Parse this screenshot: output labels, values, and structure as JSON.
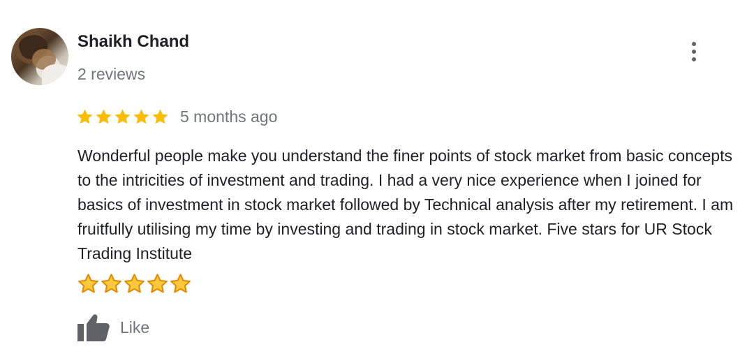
{
  "reviewer": {
    "name": "Shaikh Chand",
    "review_count": "2 reviews",
    "avatar_icon": "user-photo"
  },
  "menu": {
    "icon": "more-vert-icon"
  },
  "rating": {
    "stars": 5,
    "max_stars": 5,
    "star_color": "#fbbc04",
    "time": "5 months ago"
  },
  "review": {
    "text": "Wonderful people make you understand the finer points of stock market from basic concepts to the intricities of investment and trading. I had a very nice experience when I joined for basics of investment in stock market followed by Technical analysis after my retirement. I am fruitfully utilising my time by investing and trading in stock market. Five stars for UR Stock Trading Institute",
    "emoji": "⭐⭐⭐⭐⭐"
  },
  "actions": {
    "like_label": "Like",
    "like_icon": "thumbs-up-icon",
    "icon_color": "#5f6368"
  }
}
